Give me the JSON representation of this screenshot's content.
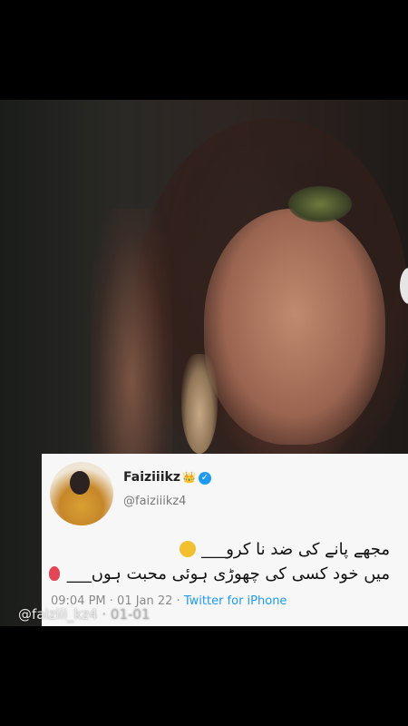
{
  "tweet": {
    "display_name": "Faiziiikz",
    "name_emoji": "👑",
    "verified_symbol": "✓",
    "handle": "@faiziiikz4",
    "line1": "مجھے پانے کی ضد نا کرو___",
    "line2": "میں خود کسی کی چھوڑی ہوئی محبت ہوں___",
    "time": "09:04 PM · 01 Jan 22 · ",
    "app": "Twitter for iPhone"
  },
  "watermark": {
    "handle": "@faiziii_kz4",
    "date": " · 01-01"
  },
  "colors": {
    "verified_blue": "#1d9bf0",
    "card_bg": "#f7f7f8"
  },
  "icons": {
    "verified": "verified-badge-icon",
    "crown": "crown-emoji-icon",
    "face": "neutral-face-emoji-icon",
    "balloon": "balloon-emoji-icon"
  }
}
